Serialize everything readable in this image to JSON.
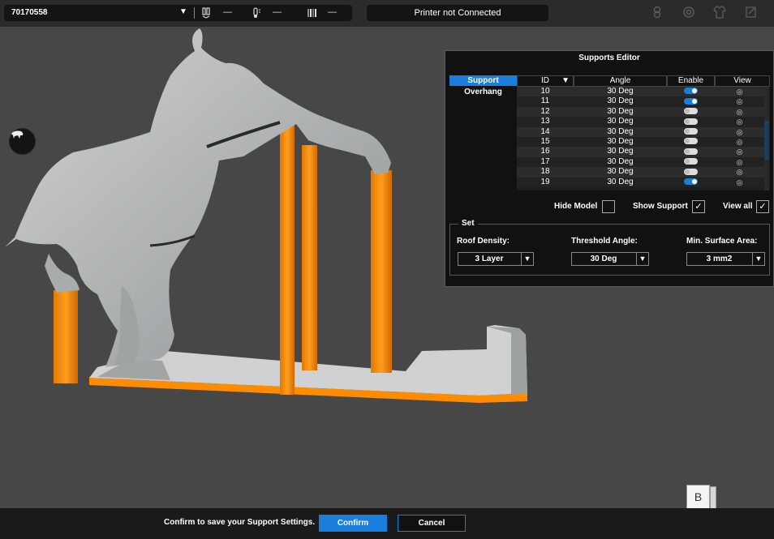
{
  "topbar": {
    "model_name": "70170558",
    "dropdown_arrow": "▼",
    "icons": [
      "nozzle-temp-icon",
      "bed-temp-icon",
      "filament-icon"
    ],
    "dash": "—",
    "printer_status": "Printer not Connected",
    "right_icons": [
      "camera-icon",
      "settings-icon",
      "shirt-icon",
      "edit-icon"
    ]
  },
  "editor": {
    "title": "Supports Editor",
    "tabs": {
      "support": "Support",
      "overhang": "Overhang"
    },
    "columns": {
      "id": "ID",
      "sort_arrow": "▼",
      "angle": "Angle",
      "enable": "Enable",
      "view": "View"
    },
    "rows": [
      {
        "id": "10",
        "angle": "30 Deg",
        "enabled": true
      },
      {
        "id": "11",
        "angle": "30 Deg",
        "enabled": true
      },
      {
        "id": "12",
        "angle": "30 Deg",
        "enabled": false
      },
      {
        "id": "13",
        "angle": "30 Deg",
        "enabled": false
      },
      {
        "id": "14",
        "angle": "30 Deg",
        "enabled": false
      },
      {
        "id": "15",
        "angle": "30 Deg",
        "enabled": false
      },
      {
        "id": "16",
        "angle": "30 Deg",
        "enabled": false
      },
      {
        "id": "17",
        "angle": "30 Deg",
        "enabled": false
      },
      {
        "id": "18",
        "angle": "30 Deg",
        "enabled": false
      },
      {
        "id": "19",
        "angle": "30 Deg",
        "enabled": true
      }
    ],
    "eye_glyph": "◎",
    "checks": {
      "hide_model": {
        "label": "Hide Model",
        "checked": false
      },
      "show_support": {
        "label": "Show Support",
        "checked": true
      },
      "view_all": {
        "label": "View all",
        "checked": true
      }
    },
    "check_mark": "✓",
    "set": {
      "legend": "Set",
      "roof_density": {
        "label": "Roof Density:",
        "value": "3 Layer"
      },
      "threshold_angle": {
        "label": "Threshold Angle:",
        "value": "30 Deg"
      },
      "min_surface_area": {
        "label": "Min. Surface Area:",
        "value": "3 mm2"
      },
      "arrow": "▼"
    }
  },
  "cube_label": "B",
  "bottombar": {
    "message": "Confirm to save your Support Settings.",
    "confirm": "Confirm",
    "cancel": "Cancel"
  },
  "colors": {
    "accent": "#1a7fdc",
    "support": "#ff8c00",
    "model": "#b4b8b9"
  }
}
